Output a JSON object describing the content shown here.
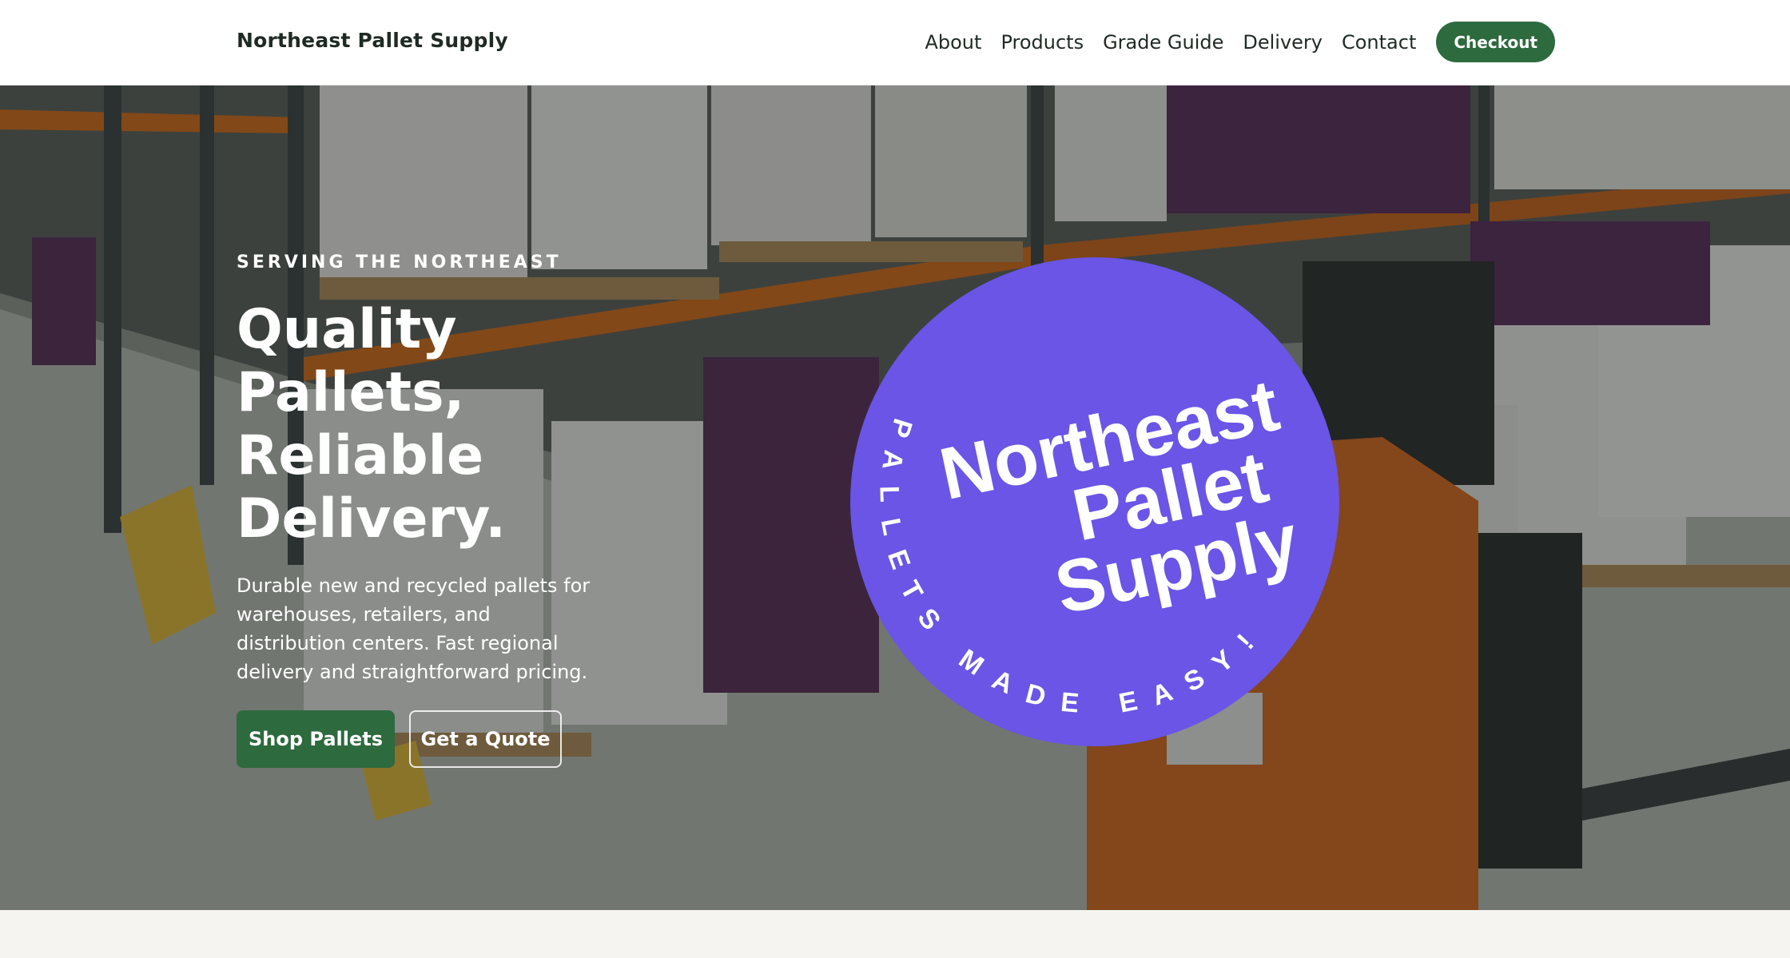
{
  "nav": {
    "brand": "Northeast Pallet Supply",
    "links": [
      "About",
      "Products",
      "Grade Guide",
      "Delivery",
      "Contact"
    ],
    "checkout_label": "Checkout"
  },
  "hero": {
    "eyebrow": "SERVING THE NORTHEAST",
    "title_lines": [
      "Quality",
      "Pallets,",
      "Reliable",
      "Delivery."
    ],
    "description_lines": [
      "Durable new and recycled pallets for",
      "warehouses, retailers, and",
      "distribution centers. Fast regional",
      "delivery and straightforward pricing."
    ],
    "primary_button": "Shop Pallets",
    "secondary_button": "Get a Quote",
    "background_image": "warehouse-shelves-with-pallets-and-orange-forklift"
  },
  "badge": {
    "lines": [
      "Northeast",
      "Pallet",
      "Supply"
    ],
    "arc_text": "PALLETS MADE EASY!",
    "color": "#6a55e6"
  },
  "colors": {
    "accent_green": "#2d6a3e",
    "badge_purple": "#6a55e6",
    "page_bg": "#f5f4f0"
  }
}
